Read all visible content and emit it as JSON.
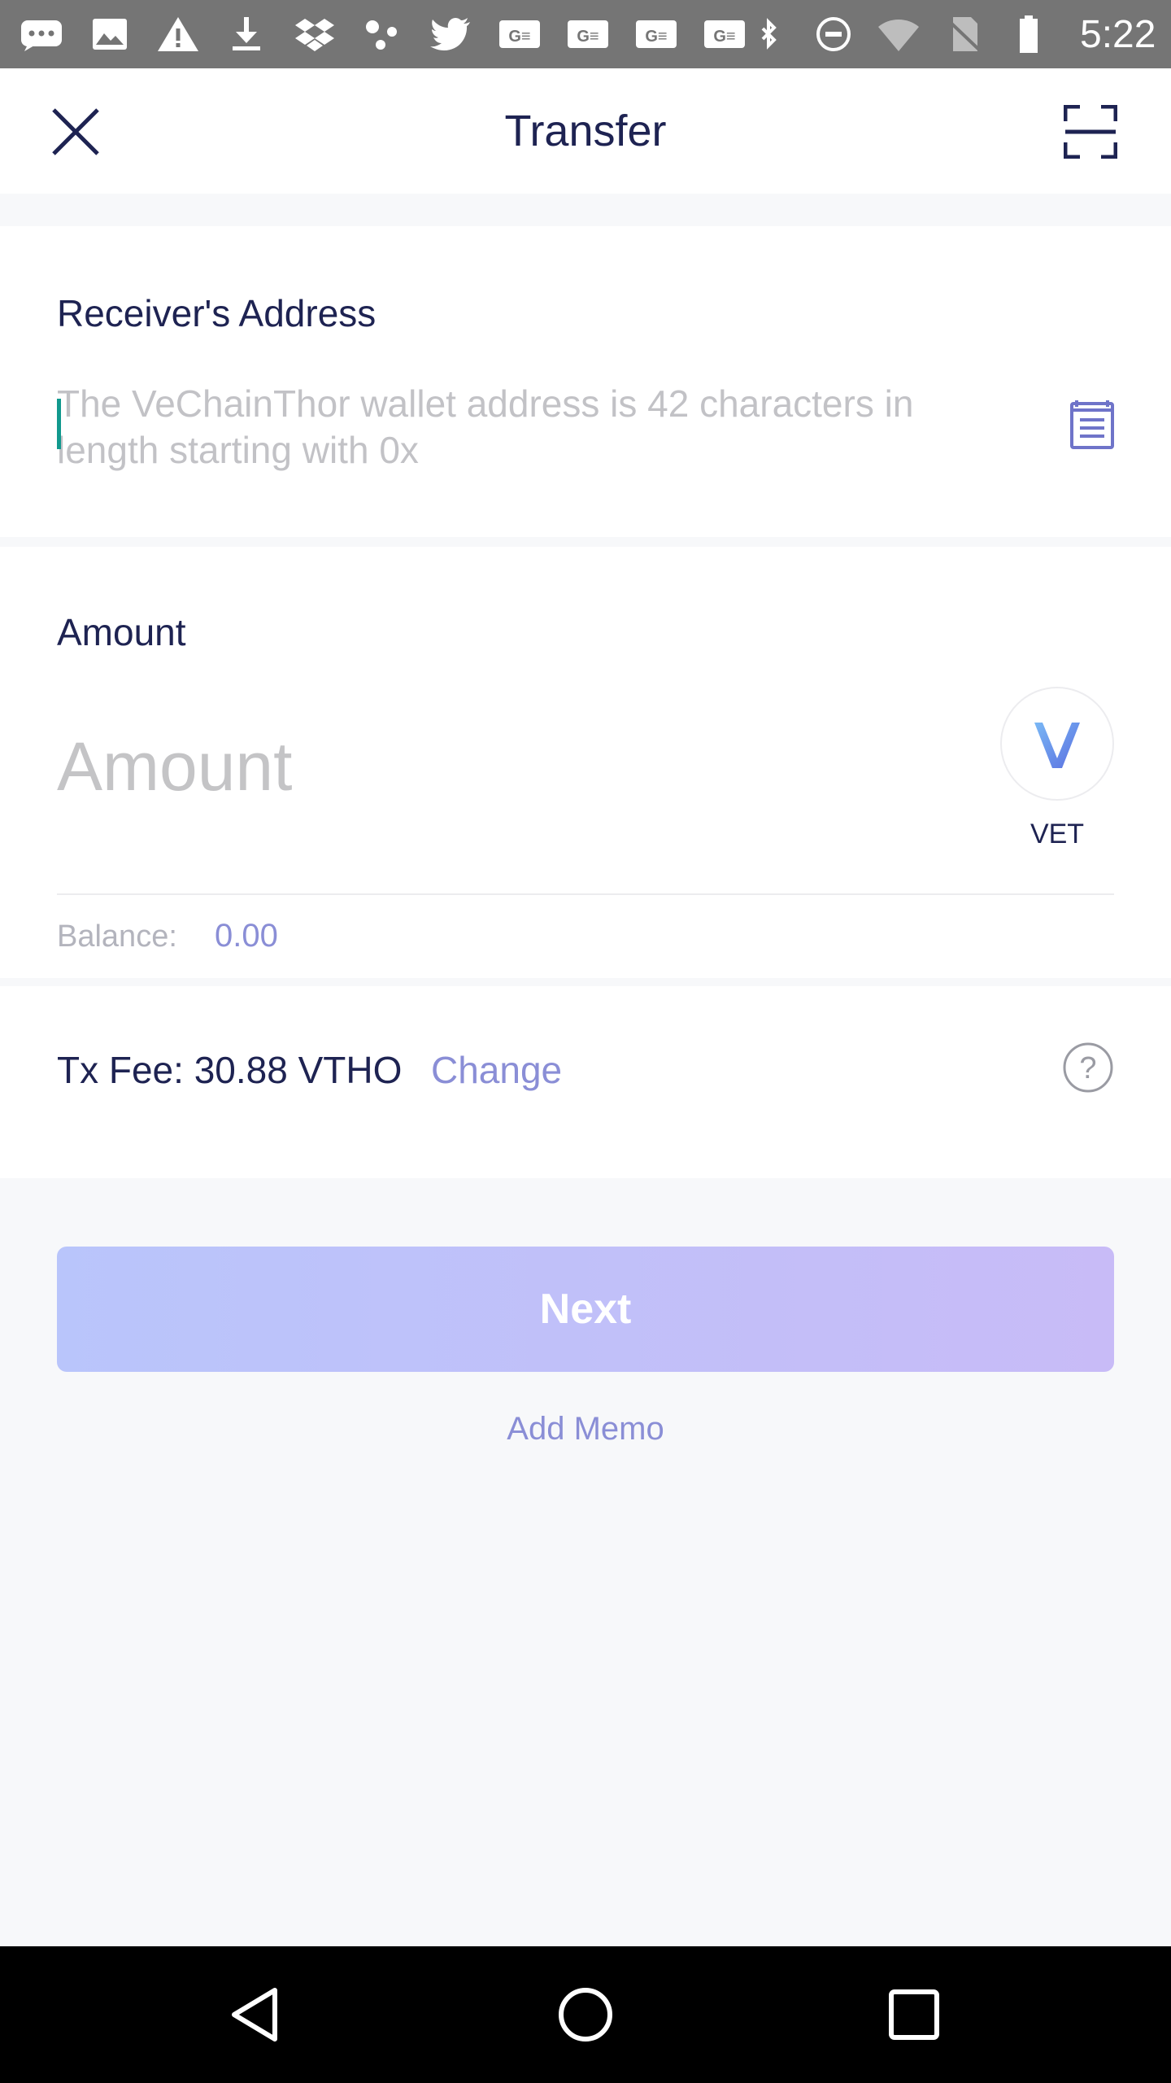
{
  "status_bar": {
    "time": "5:22",
    "left_icons": [
      "messaging-icon",
      "image-icon",
      "warning-icon",
      "download-icon",
      "dropbox-icon",
      "dots-icon",
      "twitter-icon",
      "ge-icon",
      "ge-icon",
      "ge-icon",
      "ge-icon"
    ],
    "right_icons": [
      "bluetooth-icon",
      "do-not-disturb-icon",
      "wifi-icon",
      "no-sim-icon",
      "battery-icon"
    ]
  },
  "header": {
    "title": "Transfer"
  },
  "receiver": {
    "label": "Receiver's Address",
    "placeholder": "The VeChainThor wallet address is 42 characters in length starting with 0x",
    "value": ""
  },
  "amount": {
    "label": "Amount",
    "placeholder": "Amount",
    "value": "",
    "token_symbol": "VET",
    "balance_label": "Balance:",
    "balance_value": "0.00"
  },
  "fee": {
    "text": "Tx Fee: 30.88 VTHO",
    "change_label": "Change"
  },
  "actions": {
    "next_label": "Next",
    "memo_label": "Add Memo"
  },
  "colors": {
    "primary_text": "#1e2352",
    "accent": "#8a8ed6",
    "placeholder": "#c2c2c6",
    "button_gradient_start": "#b9c5fb",
    "button_gradient_end": "#c8bbf7",
    "caret": "#11998e"
  }
}
